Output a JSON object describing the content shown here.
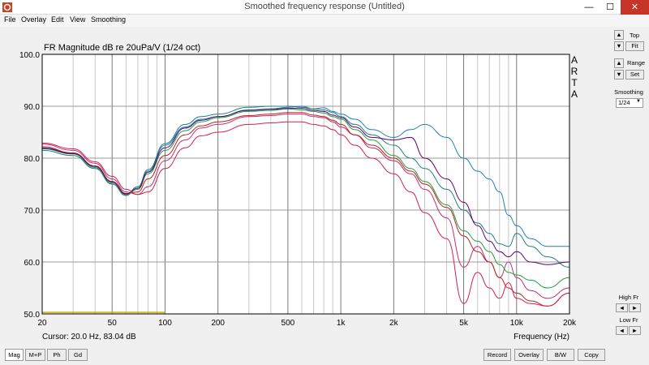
{
  "window": {
    "title": "Smoothed frequency response (Untitled)",
    "minimize": "—",
    "maximize": "☐",
    "close": "✕"
  },
  "menu": [
    "File",
    "Overlay",
    "Edit",
    "View",
    "Smoothing"
  ],
  "chart_data": {
    "type": "line",
    "title": "FR Magnitude dB re 20uPa/V (1/24 oct)",
    "xlabel": "Frequency (Hz)",
    "ylabel": "",
    "x_scale": "log",
    "xlim": [
      20,
      20000
    ],
    "ylim": [
      50,
      100
    ],
    "x_ticks": [
      20,
      50,
      100,
      200,
      500,
      1000,
      2000,
      5000,
      10000,
      20000
    ],
    "x_tick_labels": [
      "20",
      "50",
      "100",
      "200",
      "500",
      "1k",
      "2k",
      "5k",
      "10k",
      "20k"
    ],
    "y_ticks": [
      50,
      60,
      70,
      80,
      90,
      100
    ],
    "y_tick_labels": [
      "50.0",
      "60.0",
      "70.0",
      "80.0",
      "90.0",
      "100.0"
    ],
    "grid": true,
    "watermark": [
      "A",
      "R",
      "T",
      "A"
    ],
    "cursor_text": "Cursor: 20.0 Hz, 83.04 dB",
    "series": [
      {
        "color": "#2080c0",
        "x": [
          20,
          30,
          40,
          50,
          60,
          70,
          80,
          100,
          130,
          160,
          200,
          300,
          400,
          500,
          600,
          700,
          800,
          900,
          1000,
          1200,
          1500,
          2000,
          2500,
          3000,
          4000,
          5000,
          6000,
          7000,
          8000,
          9000,
          10000,
          12000,
          15000,
          20000
        ],
        "y": [
          82,
          81,
          78.5,
          75.5,
          73,
          74.5,
          77.5,
          82.5,
          86,
          87.5,
          88,
          89.3,
          89.5,
          89.8,
          90,
          89.5,
          89.7,
          89,
          88.5,
          87.5,
          85.5,
          84,
          85.5,
          86.5,
          84,
          80,
          77.5,
          76,
          73.5,
          69,
          67,
          64.5,
          63,
          63
        ]
      },
      {
        "color": "#208080",
        "x": [
          20,
          30,
          40,
          50,
          60,
          70,
          80,
          100,
          130,
          160,
          200,
          300,
          400,
          500,
          600,
          700,
          800,
          900,
          1000,
          1200,
          1500,
          2000,
          2500,
          3000,
          4000,
          5000,
          6000,
          7000,
          8000,
          9000,
          10000,
          12000,
          15000,
          20000
        ],
        "y": [
          81.5,
          80.5,
          78,
          75,
          72.8,
          74.5,
          77.8,
          82.8,
          86.5,
          88,
          88.5,
          89.8,
          90,
          90,
          89.8,
          89.5,
          89.3,
          88.8,
          88,
          86.5,
          84.5,
          82.5,
          80,
          78,
          74,
          70,
          67.5,
          65.5,
          63.5,
          63,
          65.5,
          63,
          61,
          59
        ]
      },
      {
        "color": "#c03070",
        "x": [
          20,
          30,
          40,
          50,
          60,
          70,
          80,
          100,
          130,
          160,
          200,
          300,
          400,
          500,
          600,
          700,
          800,
          900,
          1000,
          1200,
          1500,
          2000,
          2500,
          3000,
          4000,
          5000,
          6000,
          7000,
          8000,
          9000,
          10000,
          12000,
          15000,
          20000
        ],
        "y": [
          82.7,
          81.5,
          79,
          76,
          73.5,
          73,
          74.5,
          79.5,
          83.5,
          85.8,
          86.5,
          88,
          88.2,
          88.5,
          88.5,
          88,
          87.8,
          87,
          86,
          84.5,
          82,
          79.5,
          77,
          74,
          68.5,
          59,
          63,
          60,
          57,
          60,
          57,
          54.5,
          53,
          55
        ]
      },
      {
        "color": "#c02020",
        "x": [
          20,
          30,
          40,
          50,
          60,
          70,
          80,
          100,
          130,
          160,
          200,
          300,
          400,
          500,
          600,
          700,
          800,
          900,
          1000,
          1200,
          1500,
          2000,
          2500,
          3000,
          4000,
          5000,
          6000,
          7000,
          8000,
          9000,
          10000,
          12000,
          15000,
          20000
        ],
        "y": [
          82.2,
          81,
          78.5,
          75.5,
          73.2,
          73.5,
          76,
          80.5,
          84.5,
          86.2,
          87,
          88.2,
          88.5,
          88.8,
          88.8,
          88.3,
          88,
          87.3,
          86.5,
          84.5,
          82.5,
          80,
          77.5,
          75,
          70.5,
          65,
          62,
          60,
          57,
          55,
          54,
          52.5,
          51.5,
          54
        ]
      },
      {
        "color": "#20a040",
        "x": [
          20,
          30,
          40,
          50,
          60,
          70,
          80,
          100,
          130,
          160,
          200,
          300,
          400,
          500,
          600,
          700,
          800,
          900,
          1000,
          1200,
          1500,
          2000,
          2500,
          3000,
          4000,
          5000,
          6000,
          7000,
          8000,
          9000,
          10000,
          12000,
          15000,
          20000
        ],
        "y": [
          81.8,
          80.8,
          78.2,
          75.2,
          73,
          74,
          77,
          81.5,
          85.3,
          87,
          87.8,
          89,
          89.2,
          89.5,
          89.3,
          89,
          88.7,
          88,
          87.5,
          85.5,
          83.5,
          80.5,
          78,
          75.5,
          71,
          66,
          64,
          62,
          59.5,
          58,
          57.5,
          56.5,
          55,
          57
        ]
      },
      {
        "color": "#600070",
        "x": [
          20,
          30,
          40,
          50,
          60,
          70,
          80,
          100,
          130,
          160,
          200,
          300,
          400,
          500,
          600,
          700,
          800,
          900,
          1000,
          1200,
          1500,
          2000,
          2500,
          3000,
          4000,
          5000,
          6000,
          7000,
          8000,
          9000,
          10000,
          12000,
          15000,
          20000
        ],
        "y": [
          81.9,
          80.9,
          78.4,
          75.4,
          73.1,
          74.2,
          77.3,
          82,
          85.8,
          87.3,
          88,
          89.2,
          89.4,
          89.6,
          89.6,
          89.2,
          89,
          88.3,
          87.8,
          86,
          84,
          83.5,
          84,
          80,
          76,
          71.5,
          67,
          64,
          62,
          61,
          62,
          60,
          59.5,
          60
        ]
      },
      {
        "color": "#d02050",
        "x": [
          20,
          30,
          40,
          50,
          60,
          70,
          80,
          100,
          130,
          160,
          200,
          300,
          400,
          500,
          600,
          700,
          800,
          900,
          1000,
          1200,
          1500,
          2000,
          2500,
          3000,
          4000,
          5000,
          6000,
          7000,
          8000,
          9000,
          10000,
          12000,
          15000,
          20000
        ],
        "y": [
          82.9,
          81.8,
          79.3,
          76.5,
          74,
          73,
          73.5,
          78,
          82,
          84.3,
          85,
          86.5,
          86.8,
          87,
          87,
          86.5,
          86.2,
          85.5,
          84.5,
          82.5,
          80,
          77,
          73.5,
          69.5,
          64.5,
          52,
          58,
          55,
          53,
          56,
          53,
          52,
          51.5,
          54
        ]
      },
      {
        "color": "#c8b000",
        "x": [
          20,
          100
        ],
        "y": [
          50.3,
          50.3
        ]
      }
    ]
  },
  "sidebar": {
    "top_label": "Top",
    "fit": "Fit",
    "range_label": "Range",
    "set": "Set",
    "smoothing_label": "Smoothing",
    "smoothing_value": "1/24",
    "highfr_label": "High Fr",
    "lowfr_label": "Low Fr",
    "up": "▲",
    "down": "▼",
    "left": "◄",
    "right": "►",
    "dd_arrow": "▼"
  },
  "bottom": {
    "mag": "Mag",
    "mp": "M+P",
    "ph": "Ph",
    "gd": "Gd",
    "record": "Record",
    "overlay": "Overlay",
    "bw": "B/W",
    "copy": "Copy"
  },
  "colors": {
    "close_button": "#c7342a",
    "plot_background": "#ffffff",
    "grid": "#999999"
  }
}
